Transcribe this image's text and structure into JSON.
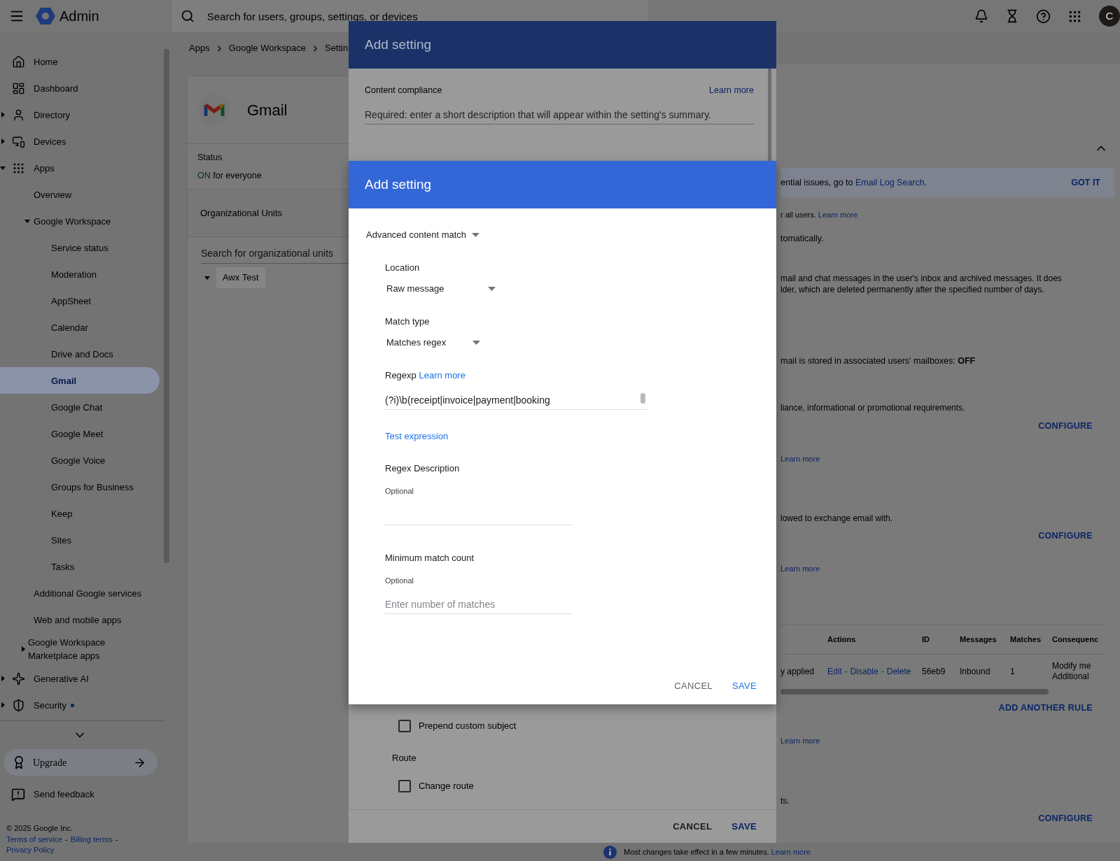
{
  "app": {
    "name": "Admin"
  },
  "search": {
    "placeholder": "Search for users, groups, settings, or devices"
  },
  "account": {
    "initial": "C"
  },
  "sidebar": {
    "items": [
      {
        "label": "Home",
        "selected": false
      },
      {
        "label": "Dashboard",
        "selected": false
      },
      {
        "label": "Directory",
        "selected": false,
        "expanded": false
      },
      {
        "label": "Devices",
        "selected": false,
        "expanded": false
      },
      {
        "label": "Apps",
        "selected": false,
        "expanded": true,
        "children": [
          {
            "label": "Overview",
            "selected": false
          },
          {
            "label": "Google Workspace",
            "selected": false,
            "expanded": true,
            "children": [
              {
                "label": "Service status",
                "selected": false
              },
              {
                "label": "Moderation",
                "selected": false
              },
              {
                "label": "AppSheet",
                "selected": false
              },
              {
                "label": "Calendar",
                "selected": false
              },
              {
                "label": "Drive and Docs",
                "selected": false
              },
              {
                "label": "Gmail",
                "selected": true
              },
              {
                "label": "Google Chat",
                "selected": false
              },
              {
                "label": "Google Meet",
                "selected": false
              },
              {
                "label": "Google Voice",
                "selected": false
              },
              {
                "label": "Groups for Business",
                "selected": false
              },
              {
                "label": "Keep",
                "selected": false
              },
              {
                "label": "Sites",
                "selected": false
              },
              {
                "label": "Tasks",
                "selected": false
              }
            ]
          },
          {
            "label": "Additional Google services",
            "selected": false
          },
          {
            "label": "Web and mobile apps",
            "selected": false
          },
          {
            "label": "Google Workspace Marketplace apps",
            "selected": false,
            "expanded": false
          }
        ]
      },
      {
        "label": "Generative AI",
        "selected": false,
        "expanded": false
      },
      {
        "label": "Security",
        "selected": false,
        "expanded": false,
        "notification": true
      }
    ],
    "upgrade": "Upgrade",
    "feedback": "Send feedback",
    "footer": {
      "copyright": "© 2025 Google Inc.",
      "links": [
        "Terms of service",
        "Billing terms",
        "Privacy Policy"
      ],
      "separator": "-"
    }
  },
  "breadcrumb": [
    "Apps",
    "Google Workspace",
    "Settin"
  ],
  "app_card": {
    "title": "Gmail",
    "status_label": "Status",
    "status_value": "ON",
    "status_suffix": "for everyone",
    "org_units": "Organizational Units",
    "org_search_placeholder": "Search for organizational units",
    "org_tree": [
      {
        "label": "Awx Test",
        "expanded": true
      }
    ]
  },
  "settings_panel": {
    "banner": {
      "text": "ential issues, go to",
      "link": "Email Log Search.",
      "button": "GOT IT"
    },
    "blocks": [
      {
        "kind": "note",
        "text": "r all users.",
        "link": "Learn more"
      },
      {
        "kind": "title",
        "text": "tomatically."
      },
      {
        "kind": "paragraph",
        "lines": [
          "mail and chat messages in the user's inbox and archived messages. It does",
          "lder, which are deleted permanently after the specified number of days."
        ]
      },
      {
        "kind": "title",
        "text": "mail is stored in associated users' mailboxes: **OFF**"
      },
      {
        "kind": "paragraph",
        "lines": [
          "liance, informational or promotional requirements."
        ]
      },
      {
        "kind": "action",
        "label": "CONFIGURE"
      },
      {
        "kind": "note",
        "link": "Learn more"
      },
      {
        "kind": "paragraph",
        "lines": [
          "lowed to exchange email with."
        ]
      },
      {
        "kind": "action",
        "label": "CONFIGURE"
      },
      {
        "kind": "note",
        "link": "Learn more"
      },
      {
        "kind": "table",
        "columns": [
          "Actions",
          "ID",
          "Messages",
          "Matches",
          "Consequenc"
        ],
        "rows": [
          {
            "status": "y applied",
            "actions": [
              "Edit",
              "Disable",
              "Delete"
            ],
            "separator": "-",
            "id": "56eb9",
            "messages": "Inbound",
            "matches": "1",
            "consequences": [
              "Modify me",
              "Additional"
            ]
          }
        ]
      },
      {
        "kind": "action",
        "label": "ADD ANOTHER RULE"
      },
      {
        "kind": "note",
        "link": "Learn more"
      },
      {
        "kind": "paragraph",
        "lines": [
          "ts."
        ]
      },
      {
        "kind": "action",
        "label": "CONFIGURE"
      }
    ]
  },
  "notice": {
    "text": "Most changes take effect in a few minutes.",
    "link": "Learn more"
  },
  "back_dialog": {
    "title": "Add setting",
    "section_label": "Content compliance",
    "learn_more": "Learn more",
    "description_placeholder": "Required: enter a short description that will appear within the setting's summary.",
    "options": [
      {
        "kind": "checkbox",
        "label": "Prepend custom subject",
        "checked": false
      },
      {
        "kind": "heading",
        "label": "Route"
      },
      {
        "kind": "checkbox",
        "label": "Change route",
        "checked": false
      }
    ],
    "buttons": [
      "CANCEL",
      "SAVE"
    ]
  },
  "front_dialog": {
    "title": "Add setting",
    "type": "Advanced content match",
    "fields": [
      {
        "kind": "select",
        "label": "Location",
        "value": "Raw message"
      },
      {
        "kind": "select",
        "label": "Match type",
        "value": "Matches regex"
      },
      {
        "kind": "regex",
        "label": "Regexp",
        "link": "Learn more",
        "value": "(?i)\\b(receipt|invoice|payment|booking",
        "action": "Test expression"
      },
      {
        "kind": "text",
        "label": "Regex Description",
        "hint": "Optional"
      },
      {
        "kind": "text",
        "label": "Minimum match count",
        "hint": "Optional",
        "placeholder": "Enter number of matches"
      }
    ],
    "buttons": [
      "CANCEL",
      "SAVE"
    ]
  }
}
